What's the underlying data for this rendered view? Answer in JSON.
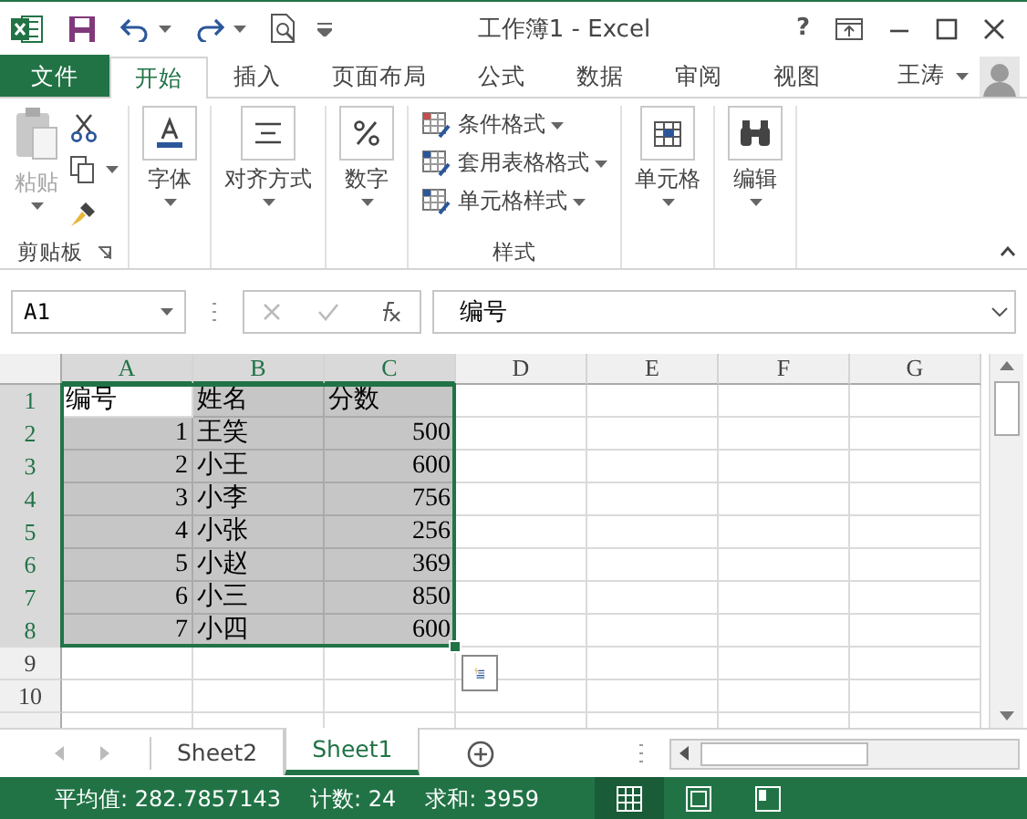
{
  "title_bar": {
    "title": "工作簿1 - Excel",
    "help": "?"
  },
  "tabs": [
    {
      "label": "文件",
      "kind": "file",
      "selected": false
    },
    {
      "label": "开始",
      "kind": "tab",
      "selected": true
    },
    {
      "label": "插入",
      "kind": "tab",
      "selected": false
    },
    {
      "label": "页面布局",
      "kind": "tab",
      "selected": false
    },
    {
      "label": "公式",
      "kind": "tab",
      "selected": false
    },
    {
      "label": "数据",
      "kind": "tab",
      "selected": false
    },
    {
      "label": "审阅",
      "kind": "tab",
      "selected": false
    },
    {
      "label": "视图",
      "kind": "tab",
      "selected": false
    }
  ],
  "user": {
    "name": "王涛"
  },
  "ribbon": {
    "groups": [
      {
        "kind": "clipboard",
        "label": "剪贴板",
        "paste": {
          "label": "粘贴",
          "disabled": true
        }
      },
      {
        "kind": "font",
        "button": "字体"
      },
      {
        "kind": "align",
        "button": "对齐方式"
      },
      {
        "kind": "number",
        "button": "数字"
      },
      {
        "kind": "styles",
        "label": "样式",
        "items": [
          {
            "label": "条件格式"
          },
          {
            "label": "套用表格格式"
          },
          {
            "label": "单元格样式"
          }
        ]
      },
      {
        "kind": "cells",
        "button": "单元格"
      },
      {
        "kind": "editing",
        "button": "编辑"
      }
    ]
  },
  "formula_bar": {
    "name_box": "A1",
    "formula": "编号"
  },
  "sheet": {
    "columns": [
      {
        "label": "A",
        "selected": true
      },
      {
        "label": "B",
        "selected": true
      },
      {
        "label": "C",
        "selected": true
      },
      {
        "label": "D",
        "selected": false
      },
      {
        "label": "E",
        "selected": false
      },
      {
        "label": "F",
        "selected": false
      },
      {
        "label": "G",
        "selected": false
      }
    ],
    "rows": [
      {
        "label": "1",
        "selected": true,
        "cells": [
          {
            "text": "编号",
            "kind": "text",
            "selected": false
          },
          {
            "text": "姓名",
            "kind": "text",
            "selected": true
          },
          {
            "text": "分数",
            "kind": "text",
            "selected": true
          }
        ]
      },
      {
        "label": "2",
        "selected": true,
        "cells": [
          {
            "text": "1",
            "kind": "number",
            "selected": true
          },
          {
            "text": "王笑",
            "kind": "text",
            "selected": true
          },
          {
            "text": "500",
            "kind": "number",
            "selected": true
          }
        ]
      },
      {
        "label": "3",
        "selected": true,
        "cells": [
          {
            "text": "2",
            "kind": "number",
            "selected": true
          },
          {
            "text": "小王",
            "kind": "text",
            "selected": true
          },
          {
            "text": "600",
            "kind": "number",
            "selected": true
          }
        ]
      },
      {
        "label": "4",
        "selected": true,
        "cells": [
          {
            "text": "3",
            "kind": "number",
            "selected": true
          },
          {
            "text": "小李",
            "kind": "text",
            "selected": true
          },
          {
            "text": "756",
            "kind": "number",
            "selected": true
          }
        ]
      },
      {
        "label": "5",
        "selected": true,
        "cells": [
          {
            "text": "4",
            "kind": "number",
            "selected": true
          },
          {
            "text": "小张",
            "kind": "text",
            "selected": true
          },
          {
            "text": "256",
            "kind": "number",
            "selected": true
          }
        ]
      },
      {
        "label": "6",
        "selected": true,
        "cells": [
          {
            "text": "5",
            "kind": "number",
            "selected": true
          },
          {
            "text": "小赵",
            "kind": "text",
            "selected": true
          },
          {
            "text": "369",
            "kind": "number",
            "selected": true
          }
        ]
      },
      {
        "label": "7",
        "selected": true,
        "cells": [
          {
            "text": "6",
            "kind": "number",
            "selected": true
          },
          {
            "text": "小三",
            "kind": "text",
            "selected": true
          },
          {
            "text": "850",
            "kind": "number",
            "selected": true
          }
        ]
      },
      {
        "label": "8",
        "selected": true,
        "cells": [
          {
            "text": "7",
            "kind": "number",
            "selected": true
          },
          {
            "text": "小四",
            "kind": "text",
            "selected": true
          },
          {
            "text": "600",
            "kind": "number",
            "selected": true
          }
        ]
      },
      {
        "label": "9",
        "selected": false,
        "cells": []
      },
      {
        "label": "10",
        "selected": false,
        "cells": []
      }
    ]
  },
  "sheet_tabs": [
    {
      "label": "Sheet2",
      "selected": false
    },
    {
      "label": "Sheet1",
      "selected": true
    }
  ],
  "status_bar": {
    "stats": [
      "平均值: 282.7857143",
      "计数: 24",
      "求和: 3959"
    ],
    "views": [
      {
        "kind": "normal",
        "selected": true
      },
      {
        "kind": "page-layout",
        "selected": false
      },
      {
        "kind": "page-break",
        "selected": false
      }
    ]
  }
}
